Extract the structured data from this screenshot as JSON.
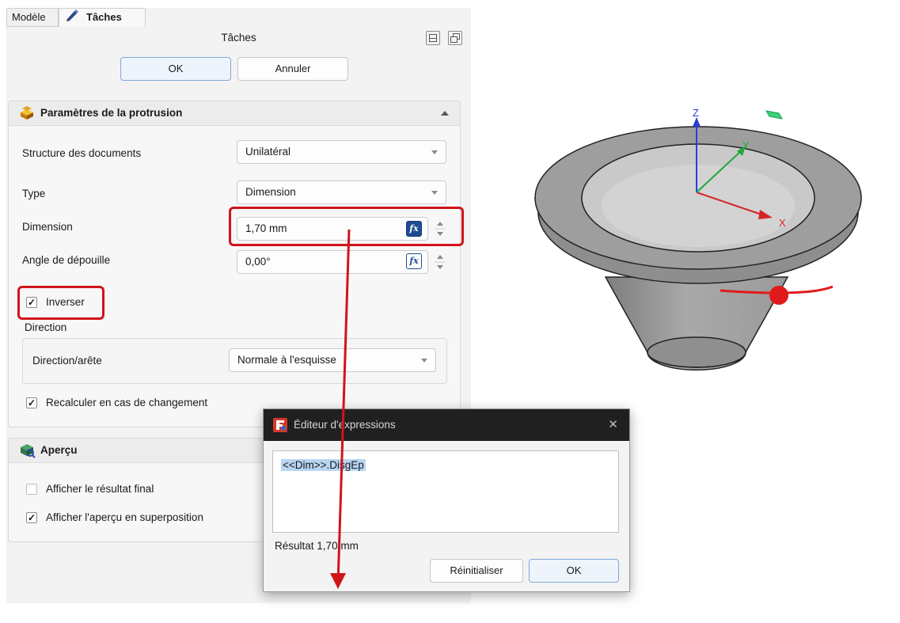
{
  "tabs": [
    {
      "label": "Modèle",
      "active": false
    },
    {
      "label": "Tâches",
      "active": true
    }
  ],
  "panel_title": "Tâches",
  "buttons": {
    "ok": "OK",
    "cancel": "Annuler"
  },
  "protrusion": {
    "title": "Paramètres de la protrusion",
    "structure_label": "Structure des documents",
    "structure_value": "Unilatéral",
    "type_label": "Type",
    "type_value": "Dimension",
    "dimension_label": "Dimension",
    "dimension_value": "1,70 mm",
    "angle_label": "Angle de dépouille",
    "angle_value": "0,00°",
    "invert_label": "Inverser",
    "invert_checked": true,
    "direction_group": "Direction",
    "direction_edge_label": "Direction/arête",
    "direction_edge_value": "Normale à l'esquisse",
    "recalc_label": "Recalculer en cas de changement",
    "recalc_checked": true
  },
  "preview": {
    "title": "Aperçu",
    "final_label": "Afficher le résultat final",
    "final_checked": false,
    "overlay_label": "Afficher l'aperçu en superposition",
    "overlay_checked": true
  },
  "expression_dialog": {
    "title": "Éditeur d'expressions",
    "expression": "<<Dim>>.DisgEp",
    "result_label": "Résultat",
    "result_value": "1,70 mm",
    "reset_button": "Réinitialiser",
    "ok_button": "OK"
  },
  "viewport": {
    "axis_x": "X",
    "axis_y": "Y",
    "axis_z": "Z",
    "colors": {
      "x": "#d42424",
      "y": "#1fa83a",
      "z": "#2a3fcf",
      "highlight": "#d0141c",
      "body": "#9a9a9a"
    }
  },
  "icons": {
    "check": "✓",
    "fx": "fx",
    "close": "✕"
  }
}
